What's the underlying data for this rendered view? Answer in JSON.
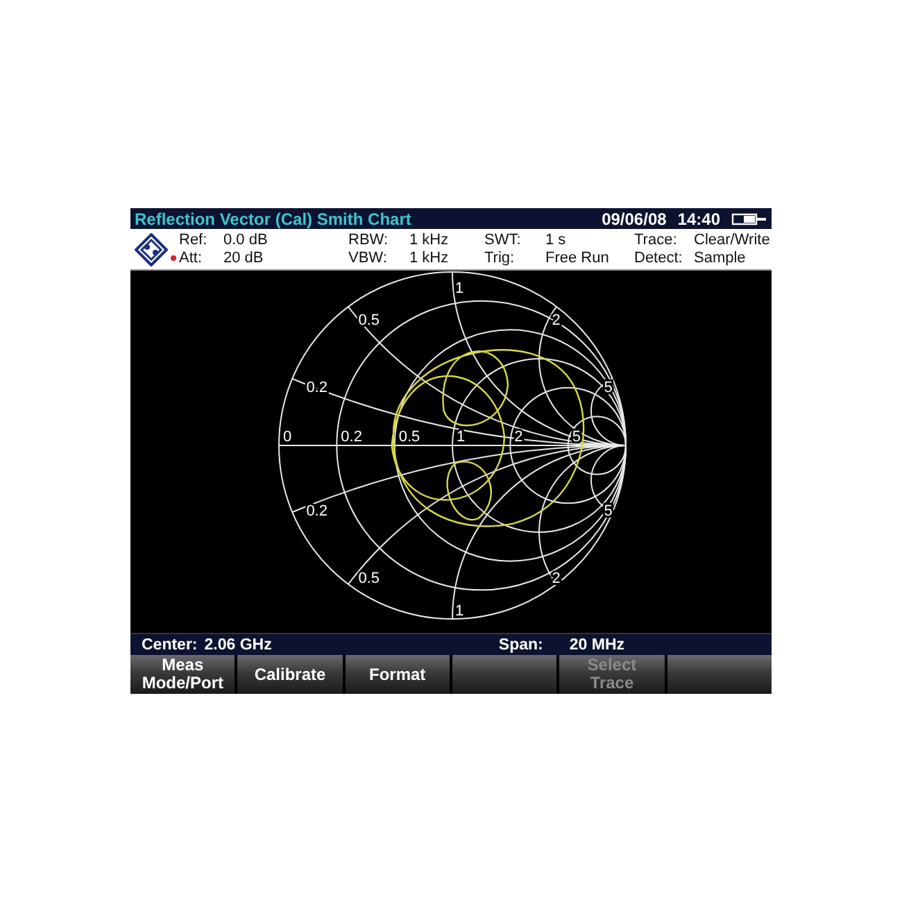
{
  "title_bar": {
    "title": "Reflection Vector (Cal) Smith Chart",
    "date": "09/06/08",
    "time": "14:40"
  },
  "settings": [
    {
      "label": "Ref:",
      "value": "0.0 dB",
      "marker": false
    },
    {
      "label": "RBW:",
      "value": "1 kHz",
      "marker": false
    },
    {
      "label": "SWT:",
      "value": "1 s",
      "marker": false
    },
    {
      "label": "Trace:",
      "value": "Clear/Write",
      "marker": false
    },
    {
      "label": "Att:",
      "value": "20 dB",
      "marker": true
    },
    {
      "label": "VBW:",
      "value": "1 kHz",
      "marker": false
    },
    {
      "label": "Trig:",
      "value": "Free Run",
      "marker": false
    },
    {
      "label": "Detect:",
      "value": "Sample",
      "marker": false
    }
  ],
  "smith_chart": {
    "resistance_labels": [
      "0",
      "0.2",
      "0.5",
      "1",
      "2",
      "5"
    ],
    "upper_reactance_labels": [
      "0.2",
      "0.5",
      "1",
      "2",
      "5"
    ],
    "lower_reactance_labels": [
      "0.2",
      "0.5",
      "1",
      "2",
      "5"
    ]
  },
  "status": {
    "center_label": "Center:",
    "center_value": "2.06 GHz",
    "span_label": "Span:",
    "span_value": "20 MHz"
  },
  "softkeys": [
    {
      "kind": "label",
      "lines": [
        "Meas",
        "Mode/Port"
      ],
      "disabled": false
    },
    {
      "kind": "label",
      "lines": [
        "Calibrate"
      ],
      "disabled": false
    },
    {
      "kind": "label",
      "lines": [
        "Format"
      ],
      "disabled": false
    },
    {
      "kind": "blank"
    },
    {
      "kind": "label",
      "lines": [
        "Select",
        "Trace"
      ],
      "disabled": true
    },
    {
      "kind": "blank"
    }
  ]
}
